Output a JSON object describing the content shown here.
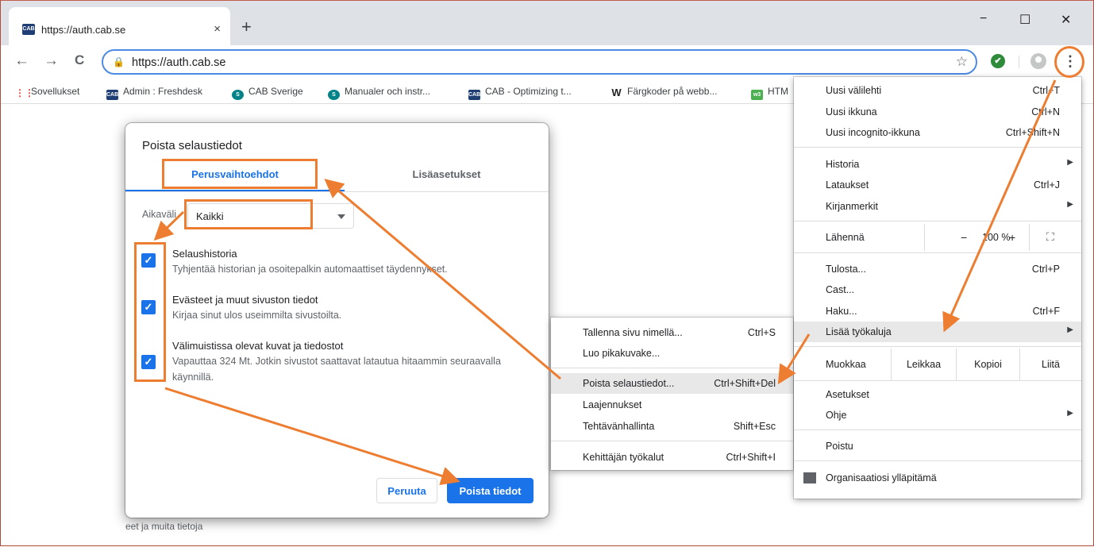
{
  "browser": {
    "tab_title": "https://auth.cab.se",
    "tab_favicon_text": "CAB",
    "tab_close": "×",
    "new_tab": "+",
    "win_min": "−",
    "win_max": "☐",
    "win_close": "✕",
    "url": "https://auth.cab.se",
    "back": "←",
    "forward": "→",
    "reload": "C",
    "star": "☆",
    "check": "✔",
    "menu_glyph": "⋮",
    "lock": "🔒"
  },
  "bookmarks": [
    {
      "label": "Sovellukset",
      "icon": "apps-icon",
      "color": "#e8453c"
    },
    {
      "label": "Admin : Freshdesk",
      "icon": "cab-icon",
      "color": "#1f3e73"
    },
    {
      "label": "CAB Sverige",
      "icon": "sharepoint-icon",
      "color": "#038387"
    },
    {
      "label": "Manualer och instr...",
      "icon": "sharepoint-icon",
      "color": "#038387"
    },
    {
      "label": "CAB - Optimizing t...",
      "icon": "cab-icon",
      "color": "#1f3e73"
    },
    {
      "label": "Färgkoder på webb...",
      "icon": "w-icon",
      "color": "#222222"
    },
    {
      "label": "HTM",
      "icon": "w3-icon",
      "color": "#4caf50"
    }
  ],
  "dialog": {
    "title": "Poista selaustiedot",
    "tab_basic": "Perusvaihtoehdot",
    "tab_advanced": "Lisäasetukset",
    "range_label": "Aikaväli",
    "range_value": "Kaikki",
    "items": [
      {
        "title": "Selaushistoria",
        "desc": "Tyhjentää historian ja osoitepalkin automaattiset täydennykset.",
        "checked": true
      },
      {
        "title": "Evästeet ja muut sivuston tiedot",
        "desc": "Kirjaa sinut ulos useimmilta sivustoilta.",
        "checked": true
      },
      {
        "title": "Välimuistissa olevat kuvat ja tiedostot",
        "desc": "Vapauttaa 324 Mt. Jotkin sivustot saattavat latautua hitaammin seuraavalla käynnillä.",
        "checked": true
      }
    ],
    "check_glyph": "✓",
    "cancel": "Peruuta",
    "delete": "Poista tiedot"
  },
  "menu": {
    "new_tab": {
      "label": "Uusi välilehti",
      "shortcut": "Ctrl+T"
    },
    "new_window": {
      "label": "Uusi ikkuna",
      "shortcut": "Ctrl+N"
    },
    "incognito": {
      "label": "Uusi incognito-ikkuna",
      "shortcut": "Ctrl+Shift+N"
    },
    "history": {
      "label": "Historia"
    },
    "downloads": {
      "label": "Lataukset",
      "shortcut": "Ctrl+J"
    },
    "bookmarks": {
      "label": "Kirjanmerkit"
    },
    "zoom": {
      "label": "Lähennä",
      "minus": "−",
      "value": "100 %",
      "plus": "+",
      "fullscreen": "⛶"
    },
    "print": {
      "label": "Tulosta...",
      "shortcut": "Ctrl+P"
    },
    "cast": {
      "label": "Cast..."
    },
    "find": {
      "label": "Haku...",
      "shortcut": "Ctrl+F"
    },
    "more_tools": {
      "label": "Lisää työkaluja"
    },
    "edit": {
      "label": "Muokkaa",
      "cut": "Leikkaa",
      "copy": "Kopioi",
      "paste": "Liitä"
    },
    "settings": {
      "label": "Asetukset"
    },
    "help": {
      "label": "Ohje"
    },
    "exit": {
      "label": "Poistu"
    },
    "managed": {
      "label": "Organisaatiosi ylläpitämä"
    },
    "arrow": "▶"
  },
  "submenu": {
    "save_page": {
      "label": "Tallenna sivu nimellä...",
      "shortcut": "Ctrl+S"
    },
    "shortcut": {
      "label": "Luo pikakuvake..."
    },
    "clear_data": {
      "label": "Poista selaustiedot...",
      "shortcut": "Ctrl+Shift+Del"
    },
    "extensions": {
      "label": "Laajennukset"
    },
    "task_manager": {
      "label": "Tehtävänhallinta",
      "shortcut": "Shift+Esc"
    },
    "dev_tools": {
      "label": "Kehittäjän työkalut",
      "shortcut": "Ctrl+Shift+I"
    }
  },
  "page_hint": "eet ja muita tietoja",
  "colors": {
    "accent": "#1a73e8",
    "annotation": "#ed7d31",
    "highlight": "#e8e8e8"
  }
}
